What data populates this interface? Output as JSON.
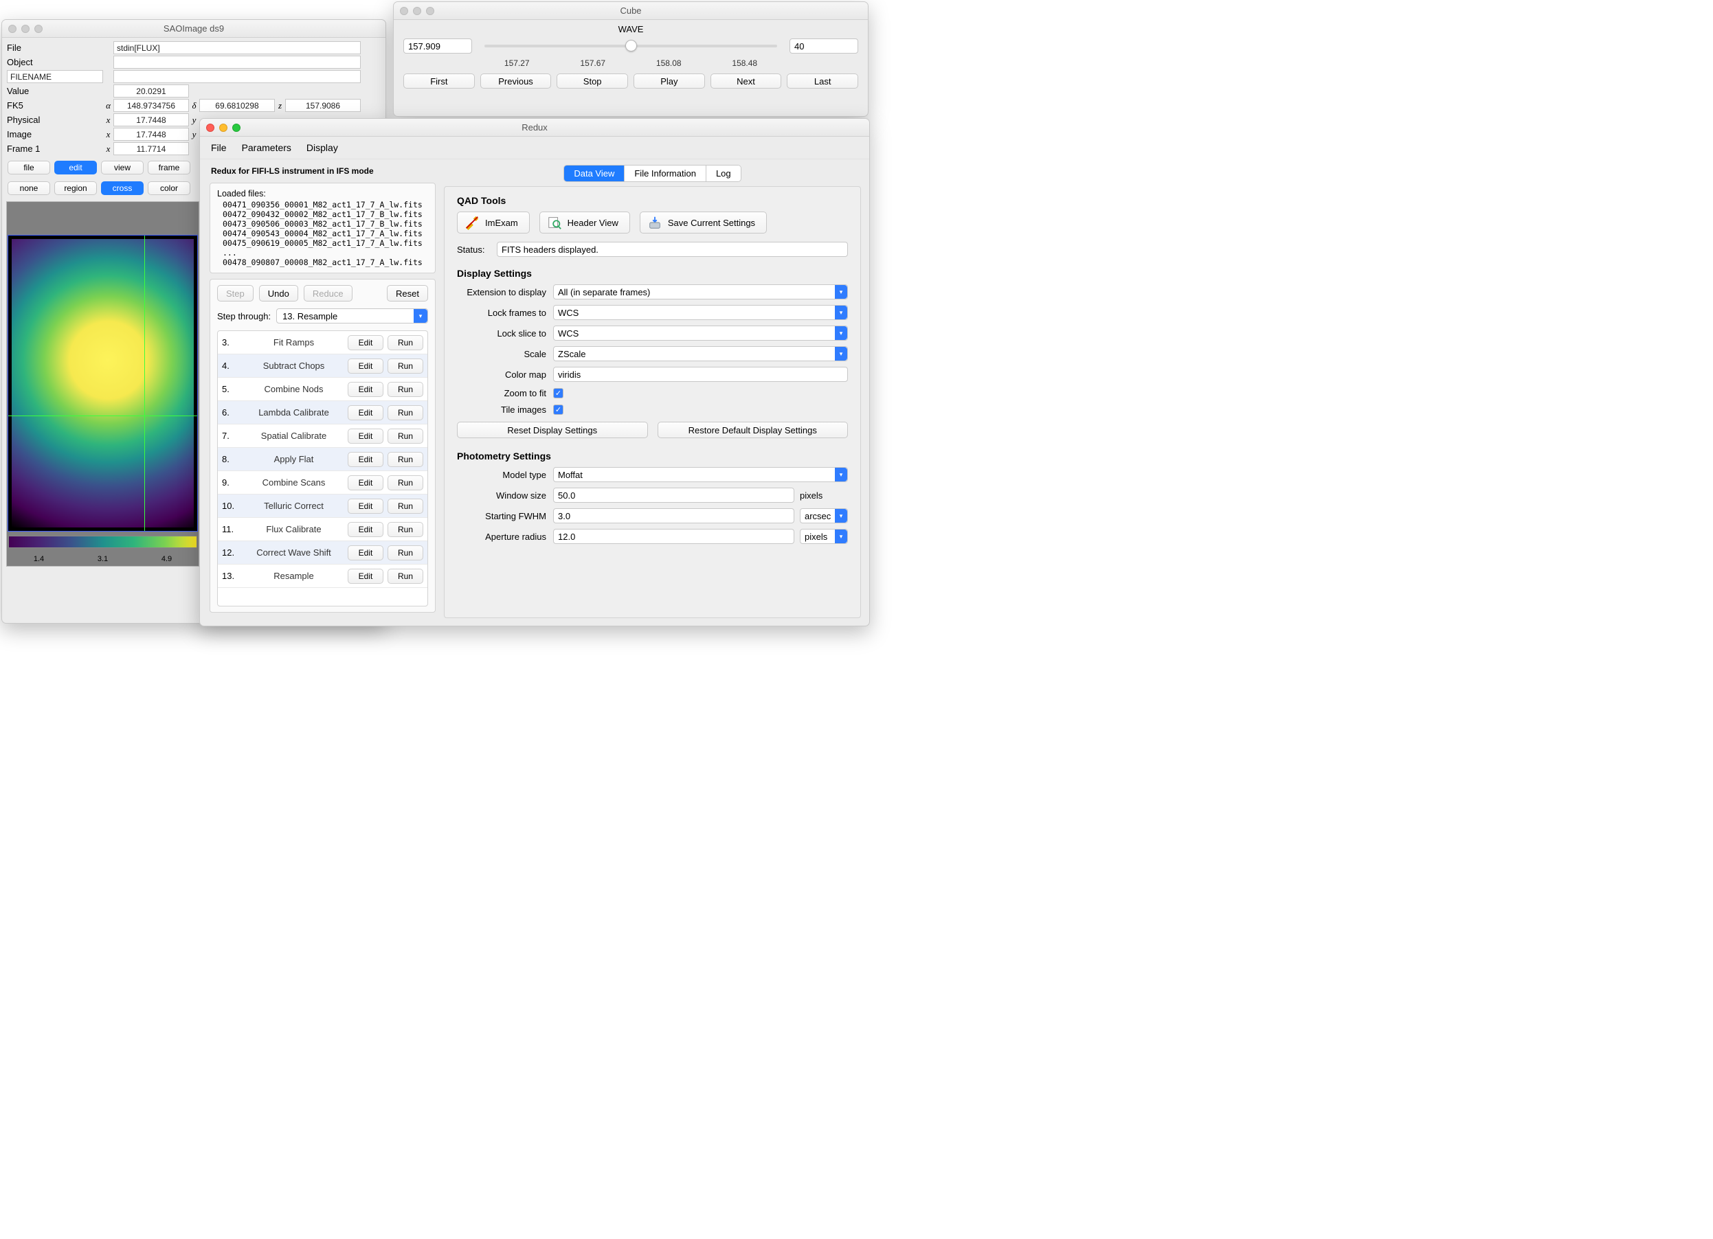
{
  "ds9": {
    "title": "SAOImage ds9",
    "rows": {
      "file_lbl": "File",
      "file_val": "stdin[FLUX]",
      "object_lbl": "Object",
      "object_val": "",
      "filename_lbl": "FILENAME",
      "value_lbl": "Value",
      "value": "20.0291",
      "fk5_lbl": "FK5",
      "fk5_a": "148.9734756",
      "fk5_d": "69.6810298",
      "fk5_z": "157.9086",
      "physical_lbl": "Physical",
      "phys_x": "17.7448",
      "image_lbl": "Image",
      "img_x": "17.7448",
      "frame_lbl": "Frame 1",
      "f_x": "11.7714",
      "alpha": "α",
      "delta": "δ",
      "z": "z",
      "x": "x",
      "y": "y"
    },
    "btns1": [
      "file",
      "edit",
      "view",
      "frame"
    ],
    "btns2": [
      "none",
      "region",
      "cross",
      "color"
    ],
    "colorbar_ticks": [
      "1.4",
      "3.1",
      "4.9"
    ]
  },
  "cube": {
    "title": "Cube",
    "axis": "WAVE",
    "left": "157.909",
    "right": "40",
    "ticks": [
      "157.27",
      "157.67",
      "158.08",
      "158.48"
    ],
    "buttons": [
      "First",
      "Previous",
      "Stop",
      "Play",
      "Next",
      "Last"
    ],
    "thumb_pct": 50
  },
  "redux": {
    "title": "Redux",
    "menus": [
      "File",
      "Parameters",
      "Display"
    ],
    "subtitle": "Redux for FIFI-LS instrument in IFS mode",
    "loaded_label": "Loaded files:",
    "files": [
      "00471_090356_00001_M82_act1_17_7_A_lw.fits",
      "00472_090432_00002_M82_act1_17_7_B_lw.fits",
      "00473_090506_00003_M82_act1_17_7_B_lw.fits",
      "00474_090543_00004_M82_act1_17_7_A_lw.fits",
      "00475_090619_00005_M82_act1_17_7_A_lw.fits",
      "...",
      "00478_090807_00008_M82_act1_17_7_A_lw.fits"
    ],
    "ctrl": {
      "step": "Step",
      "undo": "Undo",
      "reduce": "Reduce",
      "reset": "Reset"
    },
    "stepthrough_lbl": "Step through:",
    "step_selected": "13. Resample",
    "edit_lbl": "Edit",
    "run_lbl": "Run",
    "steps": [
      {
        "n": "3.",
        "name": "Fit Ramps"
      },
      {
        "n": "4.",
        "name": "Subtract Chops"
      },
      {
        "n": "5.",
        "name": "Combine Nods"
      },
      {
        "n": "6.",
        "name": "Lambda Calibrate"
      },
      {
        "n": "7.",
        "name": "Spatial Calibrate"
      },
      {
        "n": "8.",
        "name": "Apply Flat"
      },
      {
        "n": "9.",
        "name": "Combine Scans"
      },
      {
        "n": "10.",
        "name": "Telluric Correct"
      },
      {
        "n": "11.",
        "name": "Flux Calibrate"
      },
      {
        "n": "12.",
        "name": "Correct Wave Shift"
      },
      {
        "n": "13.",
        "name": "Resample"
      }
    ],
    "tabs": [
      "Data View",
      "File Information",
      "Log"
    ],
    "qad": {
      "title": "QAD Tools",
      "imexam": "ImExam",
      "header": "Header View",
      "save": "Save Current Settings",
      "status_lbl": "Status:",
      "status_val": "FITS headers displayed."
    },
    "display": {
      "title": "Display Settings",
      "ext_lbl": "Extension to display",
      "ext_val": "All (in separate frames)",
      "lockf_lbl": "Lock frames to",
      "lockf_val": "WCS",
      "locks_lbl": "Lock slice to",
      "locks_val": "WCS",
      "scale_lbl": "Scale",
      "scale_val": "ZScale",
      "cmap_lbl": "Color map",
      "cmap_val": "viridis",
      "zoom_lbl": "Zoom to fit",
      "tile_lbl": "Tile images",
      "reset": "Reset Display Settings",
      "restore": "Restore Default Display Settings"
    },
    "photo": {
      "title": "Photometry Settings",
      "model_lbl": "Model type",
      "model_val": "Moffat",
      "win_lbl": "Window size",
      "win_val": "50.0",
      "win_unit": "pixels",
      "fwhm_lbl": "Starting FWHM",
      "fwhm_val": "3.0",
      "fwhm_unit": "arcsec",
      "ap_lbl": "Aperture radius",
      "ap_val": "12.0",
      "ap_unit": "pixels"
    }
  }
}
